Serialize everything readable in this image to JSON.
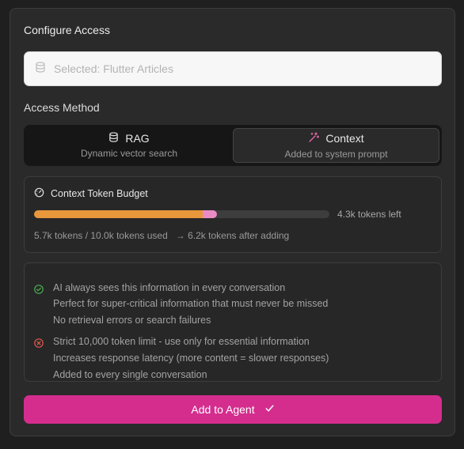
{
  "title": "Configure Access",
  "selector": {
    "icon": "database-icon",
    "text": "Selected: Flutter Articles"
  },
  "access_method": {
    "label": "Access Method",
    "options": [
      {
        "label": "RAG",
        "description": "Dynamic vector search",
        "icon": "database-icon",
        "selected": false
      },
      {
        "label": "Context",
        "description": "Added to system prompt",
        "icon": "magic-wand-icon",
        "selected": true
      }
    ]
  },
  "budget": {
    "title": "Context Token Budget",
    "icon": "gauge-icon",
    "used_fraction": 0.57,
    "after_adding_fraction": 0.62,
    "left_text": "4.3k tokens left",
    "usage_text": "5.7k tokens / 10.0k tokens used",
    "after_text": "→ 6.2k tokens after adding",
    "colors": {
      "used": "#e8973b",
      "adding": "#ea8bc3",
      "track": "#3d3d3d"
    }
  },
  "pros": {
    "icon": "check-circle-icon",
    "color": "#4caf50",
    "items": [
      "AI always sees this information in every conversation",
      "Perfect for super-critical information that must never be missed",
      "No retrieval errors or search failures"
    ]
  },
  "cons": {
    "icon": "x-circle-icon",
    "color": "#e05a4f",
    "items": [
      "Strict 10,000 token limit - use only for essential information",
      "Increases response latency (more content = slower responses)",
      "Added to every single conversation"
    ]
  },
  "add_button": {
    "label": "Add to Agent",
    "icon": "check-icon",
    "color": "#d42d8e"
  }
}
